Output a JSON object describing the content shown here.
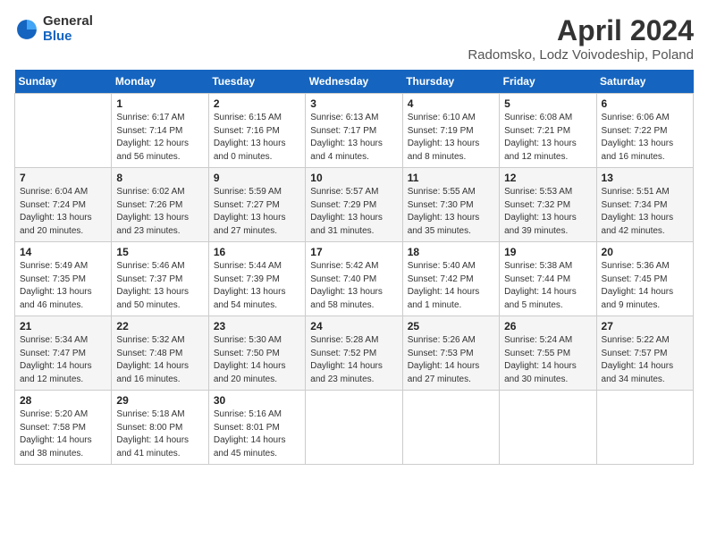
{
  "header": {
    "logo_general": "General",
    "logo_blue": "Blue",
    "month_title": "April 2024",
    "subtitle": "Radomsko, Lodz Voivodeship, Poland"
  },
  "days_of_week": [
    "Sunday",
    "Monday",
    "Tuesday",
    "Wednesday",
    "Thursday",
    "Friday",
    "Saturday"
  ],
  "weeks": [
    [
      {
        "day": "",
        "sunrise": "",
        "sunset": "",
        "daylight": ""
      },
      {
        "day": "1",
        "sunrise": "Sunrise: 6:17 AM",
        "sunset": "Sunset: 7:14 PM",
        "daylight": "Daylight: 12 hours and 56 minutes."
      },
      {
        "day": "2",
        "sunrise": "Sunrise: 6:15 AM",
        "sunset": "Sunset: 7:16 PM",
        "daylight": "Daylight: 13 hours and 0 minutes."
      },
      {
        "day": "3",
        "sunrise": "Sunrise: 6:13 AM",
        "sunset": "Sunset: 7:17 PM",
        "daylight": "Daylight: 13 hours and 4 minutes."
      },
      {
        "day": "4",
        "sunrise": "Sunrise: 6:10 AM",
        "sunset": "Sunset: 7:19 PM",
        "daylight": "Daylight: 13 hours and 8 minutes."
      },
      {
        "day": "5",
        "sunrise": "Sunrise: 6:08 AM",
        "sunset": "Sunset: 7:21 PM",
        "daylight": "Daylight: 13 hours and 12 minutes."
      },
      {
        "day": "6",
        "sunrise": "Sunrise: 6:06 AM",
        "sunset": "Sunset: 7:22 PM",
        "daylight": "Daylight: 13 hours and 16 minutes."
      }
    ],
    [
      {
        "day": "7",
        "sunrise": "Sunrise: 6:04 AM",
        "sunset": "Sunset: 7:24 PM",
        "daylight": "Daylight: 13 hours and 20 minutes."
      },
      {
        "day": "8",
        "sunrise": "Sunrise: 6:02 AM",
        "sunset": "Sunset: 7:26 PM",
        "daylight": "Daylight: 13 hours and 23 minutes."
      },
      {
        "day": "9",
        "sunrise": "Sunrise: 5:59 AM",
        "sunset": "Sunset: 7:27 PM",
        "daylight": "Daylight: 13 hours and 27 minutes."
      },
      {
        "day": "10",
        "sunrise": "Sunrise: 5:57 AM",
        "sunset": "Sunset: 7:29 PM",
        "daylight": "Daylight: 13 hours and 31 minutes."
      },
      {
        "day": "11",
        "sunrise": "Sunrise: 5:55 AM",
        "sunset": "Sunset: 7:30 PM",
        "daylight": "Daylight: 13 hours and 35 minutes."
      },
      {
        "day": "12",
        "sunrise": "Sunrise: 5:53 AM",
        "sunset": "Sunset: 7:32 PM",
        "daylight": "Daylight: 13 hours and 39 minutes."
      },
      {
        "day": "13",
        "sunrise": "Sunrise: 5:51 AM",
        "sunset": "Sunset: 7:34 PM",
        "daylight": "Daylight: 13 hours and 42 minutes."
      }
    ],
    [
      {
        "day": "14",
        "sunrise": "Sunrise: 5:49 AM",
        "sunset": "Sunset: 7:35 PM",
        "daylight": "Daylight: 13 hours and 46 minutes."
      },
      {
        "day": "15",
        "sunrise": "Sunrise: 5:46 AM",
        "sunset": "Sunset: 7:37 PM",
        "daylight": "Daylight: 13 hours and 50 minutes."
      },
      {
        "day": "16",
        "sunrise": "Sunrise: 5:44 AM",
        "sunset": "Sunset: 7:39 PM",
        "daylight": "Daylight: 13 hours and 54 minutes."
      },
      {
        "day": "17",
        "sunrise": "Sunrise: 5:42 AM",
        "sunset": "Sunset: 7:40 PM",
        "daylight": "Daylight: 13 hours and 58 minutes."
      },
      {
        "day": "18",
        "sunrise": "Sunrise: 5:40 AM",
        "sunset": "Sunset: 7:42 PM",
        "daylight": "Daylight: 14 hours and 1 minute."
      },
      {
        "day": "19",
        "sunrise": "Sunrise: 5:38 AM",
        "sunset": "Sunset: 7:44 PM",
        "daylight": "Daylight: 14 hours and 5 minutes."
      },
      {
        "day": "20",
        "sunrise": "Sunrise: 5:36 AM",
        "sunset": "Sunset: 7:45 PM",
        "daylight": "Daylight: 14 hours and 9 minutes."
      }
    ],
    [
      {
        "day": "21",
        "sunrise": "Sunrise: 5:34 AM",
        "sunset": "Sunset: 7:47 PM",
        "daylight": "Daylight: 14 hours and 12 minutes."
      },
      {
        "day": "22",
        "sunrise": "Sunrise: 5:32 AM",
        "sunset": "Sunset: 7:48 PM",
        "daylight": "Daylight: 14 hours and 16 minutes."
      },
      {
        "day": "23",
        "sunrise": "Sunrise: 5:30 AM",
        "sunset": "Sunset: 7:50 PM",
        "daylight": "Daylight: 14 hours and 20 minutes."
      },
      {
        "day": "24",
        "sunrise": "Sunrise: 5:28 AM",
        "sunset": "Sunset: 7:52 PM",
        "daylight": "Daylight: 14 hours and 23 minutes."
      },
      {
        "day": "25",
        "sunrise": "Sunrise: 5:26 AM",
        "sunset": "Sunset: 7:53 PM",
        "daylight": "Daylight: 14 hours and 27 minutes."
      },
      {
        "day": "26",
        "sunrise": "Sunrise: 5:24 AM",
        "sunset": "Sunset: 7:55 PM",
        "daylight": "Daylight: 14 hours and 30 minutes."
      },
      {
        "day": "27",
        "sunrise": "Sunrise: 5:22 AM",
        "sunset": "Sunset: 7:57 PM",
        "daylight": "Daylight: 14 hours and 34 minutes."
      }
    ],
    [
      {
        "day": "28",
        "sunrise": "Sunrise: 5:20 AM",
        "sunset": "Sunset: 7:58 PM",
        "daylight": "Daylight: 14 hours and 38 minutes."
      },
      {
        "day": "29",
        "sunrise": "Sunrise: 5:18 AM",
        "sunset": "Sunset: 8:00 PM",
        "daylight": "Daylight: 14 hours and 41 minutes."
      },
      {
        "day": "30",
        "sunrise": "Sunrise: 5:16 AM",
        "sunset": "Sunset: 8:01 PM",
        "daylight": "Daylight: 14 hours and 45 minutes."
      },
      {
        "day": "",
        "sunrise": "",
        "sunset": "",
        "daylight": ""
      },
      {
        "day": "",
        "sunrise": "",
        "sunset": "",
        "daylight": ""
      },
      {
        "day": "",
        "sunrise": "",
        "sunset": "",
        "daylight": ""
      },
      {
        "day": "",
        "sunrise": "",
        "sunset": "",
        "daylight": ""
      }
    ]
  ]
}
